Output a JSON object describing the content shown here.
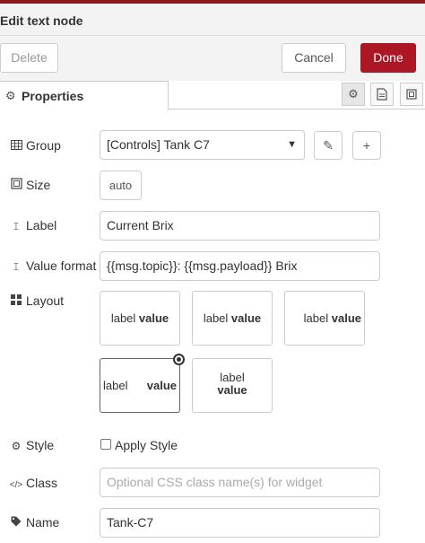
{
  "dialog": {
    "title": "Edit text node",
    "buttons": {
      "delete": "Delete",
      "cancel": "Cancel",
      "done": "Done"
    },
    "accent_color": "#ad1625"
  },
  "tabs": {
    "properties": "Properties",
    "icons": [
      "gear-icon",
      "document-icon",
      "frame-icon"
    ]
  },
  "form": {
    "group": {
      "label": "Group",
      "value": "[Controls] Tank C7"
    },
    "size": {
      "label": "Size",
      "value": "auto"
    },
    "label": {
      "label": "Label",
      "value": "Current Brix"
    },
    "value_format": {
      "label": "Value format",
      "value": "{{msg.topic}}:  {{msg.payload}} Brix"
    },
    "layout": {
      "label": "Layout",
      "options": [
        {
          "left": "label",
          "right": "value"
        },
        {
          "left": "label",
          "right": "value"
        },
        {
          "left": "label",
          "right": "value"
        },
        {
          "left": "label",
          "right": "value"
        },
        {
          "left": "label",
          "right": "value"
        }
      ],
      "selected_index": 3
    },
    "style": {
      "label": "Style",
      "checkbox_label": "Apply Style",
      "checked": false
    },
    "class": {
      "label": "Class",
      "placeholder": "Optional CSS class name(s) for widget"
    },
    "name": {
      "label": "Name",
      "value": "Tank-C7"
    }
  }
}
